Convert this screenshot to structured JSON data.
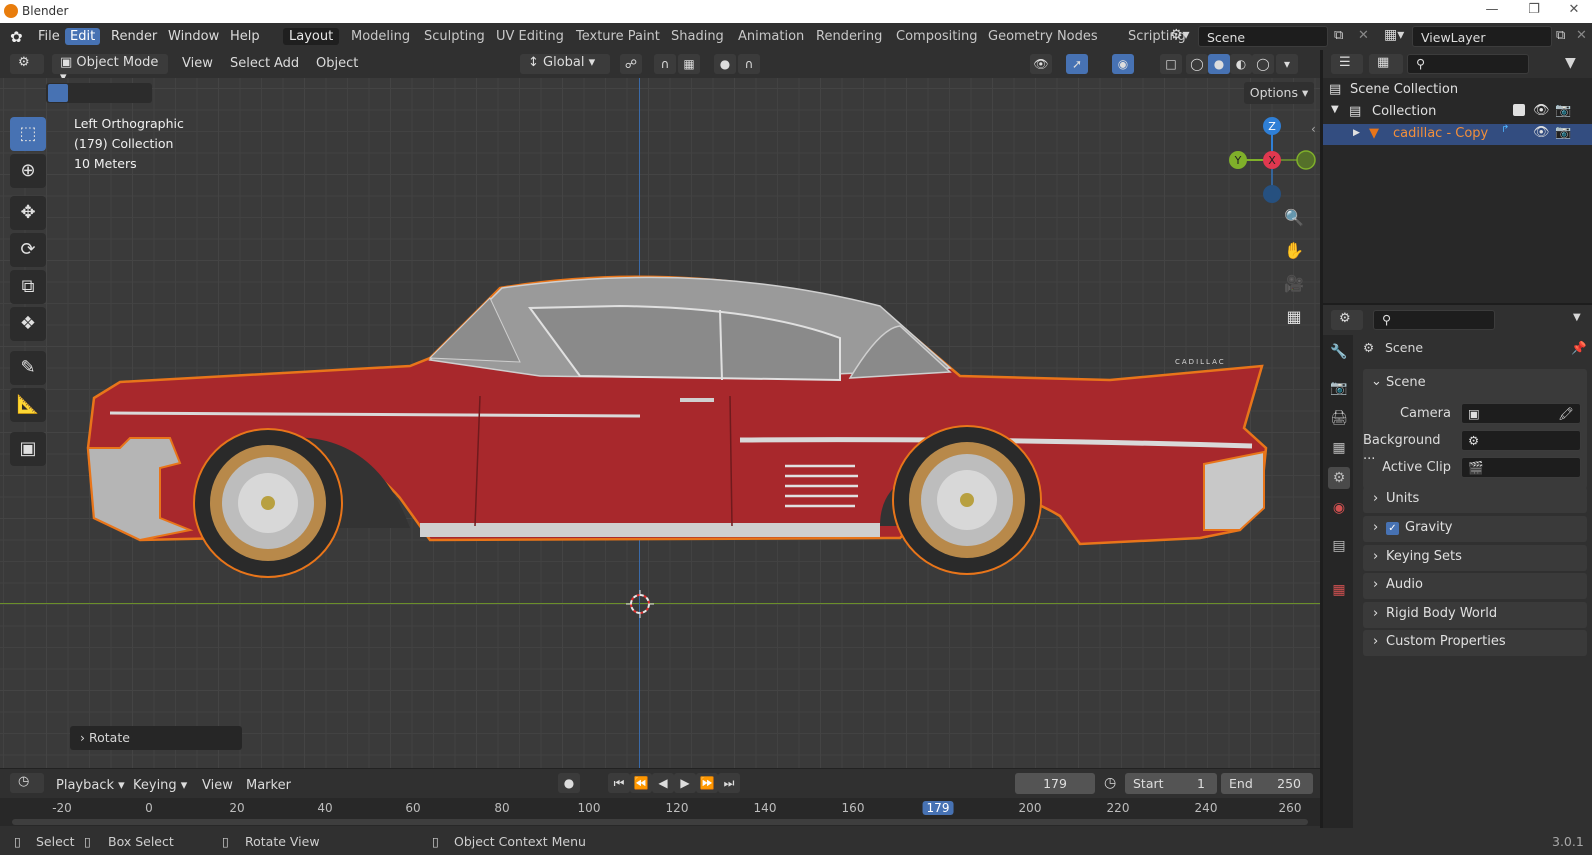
{
  "window": {
    "title": "Blender"
  },
  "menu": {
    "file": "File",
    "edit": "Edit",
    "render": "Render",
    "window": "Window",
    "help": "Help"
  },
  "workspaces": [
    "Layout",
    "Modeling",
    "Sculpting",
    "UV Editing",
    "Texture Paint",
    "Shading",
    "Animation",
    "Rendering",
    "Compositing",
    "Geometry Nodes",
    "Scripting"
  ],
  "scene_name": "Scene",
  "view_layer": "ViewLayer",
  "viewport_header": {
    "mode": "Object Mode",
    "view": "View",
    "select": "Select",
    "add": "Add",
    "object": "Object",
    "orientation": "Global"
  },
  "viewport": {
    "options": "Options",
    "info_line1": "Left Orthographic",
    "info_line2": "(179) Collection",
    "info_line3": "10 Meters",
    "last_op": "Rotate",
    "car_badge": "CADILLAC",
    "gizmo": {
      "z": "Z",
      "y": "Y",
      "x": "X"
    }
  },
  "timeline": {
    "playback": "Playback",
    "keying": "Keying",
    "view": "View",
    "marker": "Marker",
    "current_frame": "179",
    "start_label": "Start",
    "start": "1",
    "end_label": "End",
    "end": "250",
    "ticks": [
      "-20",
      "0",
      "20",
      "40",
      "60",
      "80",
      "100",
      "120",
      "140",
      "160",
      "179",
      "200",
      "220",
      "240",
      "260"
    ]
  },
  "status": {
    "select": "Select",
    "box_select": "Box Select",
    "rotate_view": "Rotate View",
    "context_menu": "Object Context Menu",
    "version": "3.0.1"
  },
  "outliner": {
    "root": "Scene Collection",
    "collection": "Collection",
    "object": "cadillac - Copy"
  },
  "properties": {
    "header": "Scene",
    "panel_title": "Scene",
    "camera_label": "Camera",
    "background_label": "Background ...",
    "active_clip_label": "Active Clip",
    "sections": [
      "Units",
      "Gravity",
      "Keying Sets",
      "Audio",
      "Rigid Body World",
      "Custom Properties"
    ]
  },
  "colors": {
    "accent": "#4772b3",
    "selection_outline": "#e8751a",
    "car_body": "#a8282c",
    "axis_x": "#e0384f",
    "axis_y": "#7fb02a",
    "axis_z": "#2f7fd6"
  }
}
